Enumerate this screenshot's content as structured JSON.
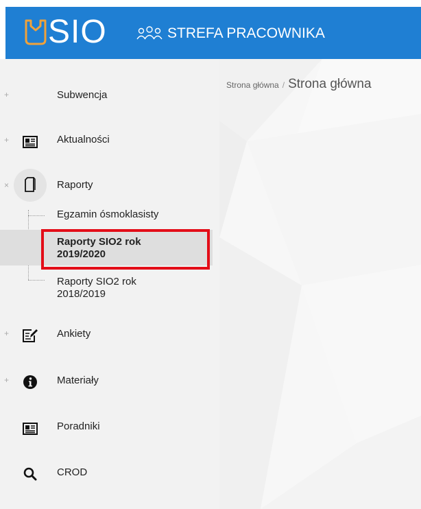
{
  "header": {
    "logo_text": "SIO",
    "zone_title": "STREFA PRACOWNIKA"
  },
  "breadcrumb": {
    "home": "Strona główna",
    "separator": "/",
    "current": "Strona główna"
  },
  "sidebar": {
    "items": [
      {
        "label": "Subwencja",
        "expander": "+",
        "icon": ""
      },
      {
        "label": "Aktualności",
        "expander": "+",
        "icon": "newspaper-icon"
      },
      {
        "label": "Raporty",
        "expander": "×",
        "icon": "document-icon"
      },
      {
        "label": "Ankiety",
        "expander": "+",
        "icon": "edit-form-icon"
      },
      {
        "label": "Materiały",
        "expander": "+",
        "icon": "info-icon"
      },
      {
        "label": "Poradniki",
        "expander": "",
        "icon": "newspaper-icon"
      },
      {
        "label": "CROD",
        "expander": "",
        "icon": "search-icon"
      }
    ],
    "raporty_children": [
      {
        "label": "Egzamin ósmoklasisty"
      },
      {
        "label_line1": "Raporty SIO2 rok",
        "label_line2": "2019/2020",
        "active": true
      },
      {
        "label_line1": "Raporty SIO2 rok",
        "label_line2": "2018/2019"
      }
    ]
  },
  "colors": {
    "header_bg": "#1f7fd3",
    "logo_accent": "#f0a23a",
    "highlight_border": "#e30d18",
    "sidebar_bg": "#f2f2f2"
  }
}
